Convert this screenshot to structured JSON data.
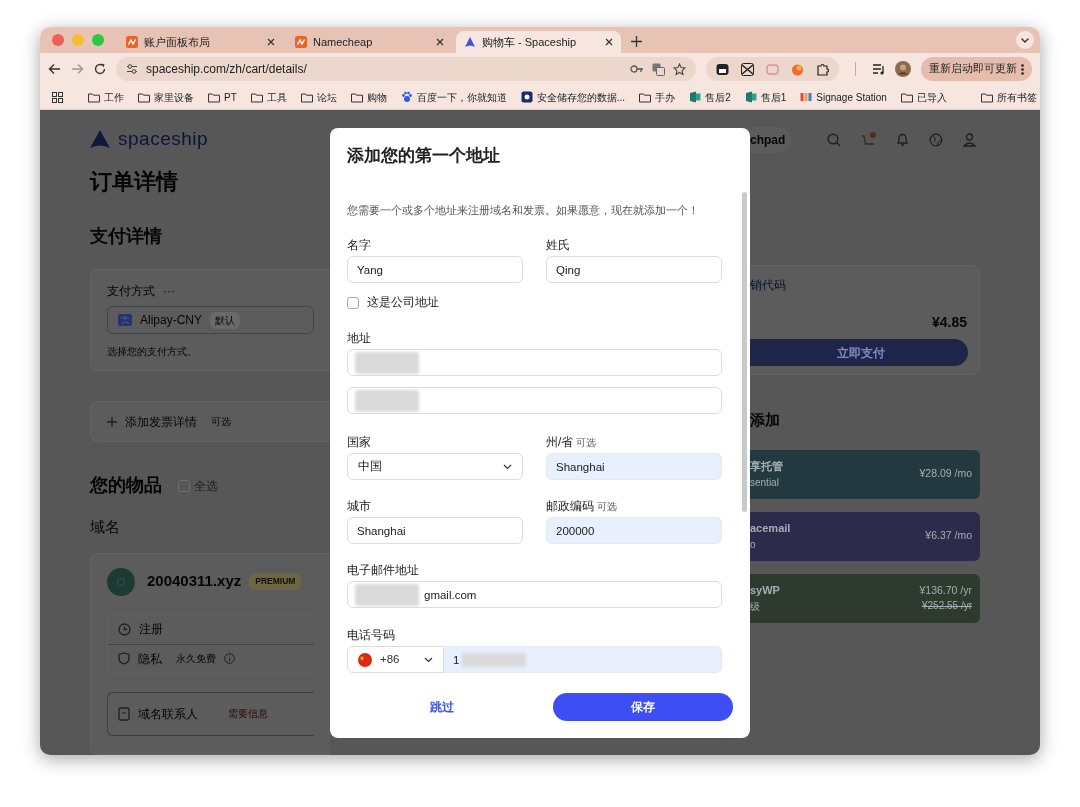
{
  "browser": {
    "tabs": [
      {
        "title": "账户面板布局",
        "kind": "orange",
        "selected": false
      },
      {
        "title": "Namecheap",
        "kind": "orange",
        "selected": false
      },
      {
        "title": "购物车 - Spaceship",
        "kind": "spaceship",
        "selected": true
      }
    ],
    "url": "spaceship.com/zh/cart/details/",
    "update_button": "重新启动即可更新",
    "bookmarks": [
      {
        "label": "工作",
        "kind": "folder"
      },
      {
        "label": "家里设备",
        "kind": "folder"
      },
      {
        "label": "PT",
        "kind": "folder"
      },
      {
        "label": "工具",
        "kind": "folder"
      },
      {
        "label": "论坛",
        "kind": "folder"
      },
      {
        "label": "购物",
        "kind": "folder"
      },
      {
        "label": "百度一下，你就知道",
        "kind": "paw"
      },
      {
        "label": "安全储存您的数据...",
        "kind": "vault"
      },
      {
        "label": "手办",
        "kind": "folder"
      },
      {
        "label": "售后2",
        "kind": "sheet"
      },
      {
        "label": "售后1",
        "kind": "sheet"
      },
      {
        "label": "Signage Station",
        "kind": "bars"
      },
      {
        "label": "已导入",
        "kind": "folder"
      }
    ],
    "all_bookmarks": "所有书签"
  },
  "page": {
    "logo": "spaceship",
    "title": "订单详情",
    "payment_heading": "支付详情",
    "payment_card": {
      "label": "支付方式",
      "more": "···",
      "method": "Alipay-CNY",
      "badge": "默认",
      "hint": "选择您的支付方式。"
    },
    "invoice": {
      "label": "添加发票详情",
      "optional": "可选"
    },
    "items_heading": "您的物品",
    "select_all": {
      "label": "全选",
      "checked": false
    },
    "domains_heading": "域名",
    "domain": {
      "name": "20040311.xyz",
      "badge": "PREMIUM",
      "rows": [
        {
          "kind": "clock",
          "label": "注册"
        },
        {
          "kind": "shield",
          "label": "隐私",
          "note": "永久免费"
        }
      ],
      "contact": {
        "label": "域名联系人",
        "status": "需要信息"
      }
    },
    "launchpad": "chpad",
    "summary": {
      "promo": "销代码",
      "total": "¥4.85",
      "pay_button": "立即支付"
    },
    "addons_heading": "添加",
    "addons": [
      {
        "title": "享托管",
        "subtitle": "sential",
        "price": "¥28.09 /mo",
        "color": "#23393f"
      },
      {
        "title": "acemail",
        "subtitle": "o",
        "price": "¥6.37 /mo",
        "color": "#2e2a4b"
      },
      {
        "title": "syWP",
        "subtitle": "级",
        "price": "¥136.70 /yr",
        "old_price": "¥252.55 /yr",
        "color": "#2d3a2d"
      }
    ]
  },
  "modal": {
    "title": "添加您的第一个地址",
    "description": "您需要一个或多个地址来注册域名和发票。如果愿意，现在就添加一个！",
    "first_name": {
      "label": "名字",
      "value": "Yang",
      "autofilled": false
    },
    "last_name": {
      "label": "姓氏",
      "value": "Qing",
      "autofilled": false
    },
    "company": {
      "label": "这是公司地址",
      "checked": false
    },
    "address": {
      "label": "地址",
      "lines": [
        {
          "blurred": true
        },
        {
          "blurred": true
        }
      ]
    },
    "country": {
      "label": "国家",
      "value": "中国"
    },
    "state": {
      "label": "州/省",
      "optional": "可选",
      "value": "Shanghai",
      "autofilled": true
    },
    "city": {
      "label": "城市",
      "value": "Shanghai",
      "autofilled": false
    },
    "postcode": {
      "label": "邮政编码",
      "optional": "可选",
      "value": "200000",
      "autofilled": true
    },
    "email": {
      "label": "电子邮件地址",
      "value": "gmail.com",
      "blurred": true,
      "autofilled": false
    },
    "phone": {
      "label": "电话号码",
      "code": "+86",
      "value": "1",
      "blurred": true,
      "autofilled": true
    },
    "skip": "跳过",
    "save": "保存"
  }
}
